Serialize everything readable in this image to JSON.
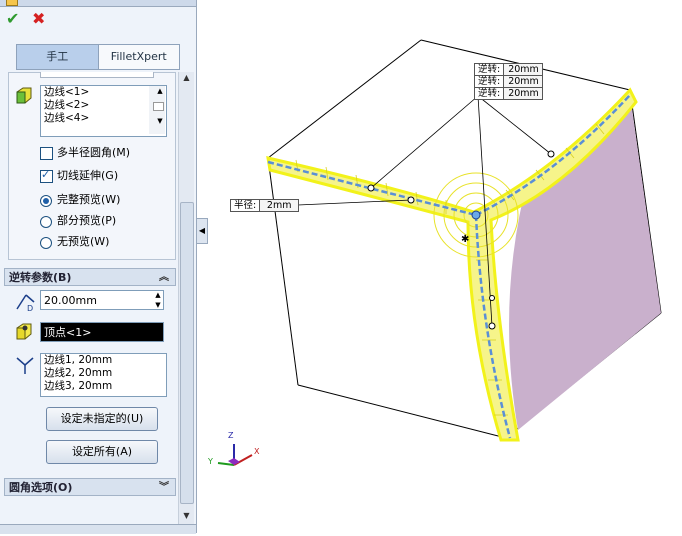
{
  "toolbar": {
    "ok_icon": "check-icon",
    "cancel_icon": "close-icon",
    "ok_glyph": "✔",
    "cancel_glyph": "✖"
  },
  "tabs": [
    {
      "label": "手工",
      "active": true
    },
    {
      "label": "FilletXpert",
      "active": false
    }
  ],
  "items_section": {
    "edges_list": [
      "边线<1>",
      "边线<2>",
      "边线<4>"
    ],
    "multi_radius": {
      "label": "多半径圆角(M)",
      "checked": false
    },
    "tangent_propagation": {
      "label": "切线延伸(G)",
      "checked": true
    },
    "preview_options": [
      {
        "label": "完整预览(W)",
        "selected": true
      },
      {
        "label": "部分预览(P)",
        "selected": false
      },
      {
        "label": "无预览(W)",
        "selected": false
      }
    ]
  },
  "setback_section": {
    "title": "逆转参数(B)",
    "distance_value": "20.00mm",
    "vertex_value": "顶点<1>",
    "setback_list": [
      "边线1, 20mm",
      "边线2, 20mm",
      "边线3, 20mm"
    ],
    "set_unassigned_button": "设定未指定的(U)",
    "set_all_button": "设定所有(A)"
  },
  "fillet_options_section": {
    "title": "圆角选项(O)"
  },
  "viewport": {
    "setback_callout": [
      {
        "key": "逆转:",
        "value": "20mm"
      },
      {
        "key": "逆转:",
        "value": "20mm"
      },
      {
        "key": "逆转:",
        "value": "20mm"
      }
    ],
    "radius_callout": {
      "key": "半径:",
      "value": "2mm"
    },
    "triad": {
      "x": "X",
      "y": "Y",
      "z": "Z"
    },
    "colors": {
      "highlight": "#f2f21a",
      "face_shaded": "#c9b0cc",
      "edge_blue": "#5a8fd6"
    }
  }
}
